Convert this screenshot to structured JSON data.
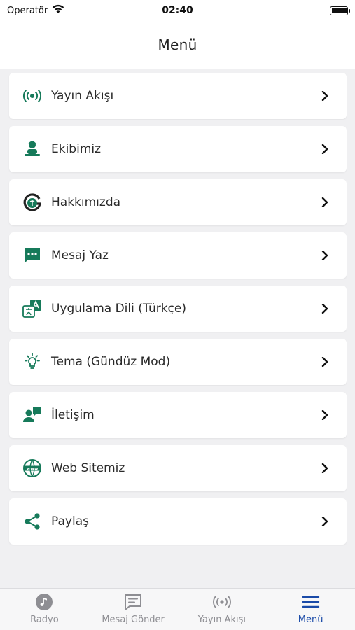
{
  "status_bar": {
    "carrier": "Operatör",
    "time": "02:40"
  },
  "nav": {
    "title": "Menü"
  },
  "colors": {
    "accent": "#167a5a",
    "tab_active": "#1a4aa8",
    "tab_inactive": "#8e8e93"
  },
  "menu": [
    {
      "label": "Yayın Akışı",
      "icon": "broadcast-icon"
    },
    {
      "label": "Ekibimiz",
      "icon": "team-icon"
    },
    {
      "label": "Hakkımızda",
      "icon": "logo-icon"
    },
    {
      "label": "Mesaj Yaz",
      "icon": "message-icon"
    },
    {
      "label": "Uygulama Dili (Türkçe)",
      "icon": "translate-icon"
    },
    {
      "label": "Tema (Gündüz Mod)",
      "icon": "lightbulb-icon"
    },
    {
      "label": "İletişim",
      "icon": "contact-icon"
    },
    {
      "label": "Web Sitemiz",
      "icon": "www-icon"
    },
    {
      "label": "Paylaş",
      "icon": "share-icon"
    }
  ],
  "tabs": [
    {
      "label": "Radyo",
      "icon": "music-note-icon",
      "active": false
    },
    {
      "label": "Mesaj Gönder",
      "icon": "chat-icon",
      "active": false
    },
    {
      "label": "Yayın Akışı",
      "icon": "broadcast-icon",
      "active": false
    },
    {
      "label": "Menü",
      "icon": "hamburger-icon",
      "active": true
    }
  ]
}
